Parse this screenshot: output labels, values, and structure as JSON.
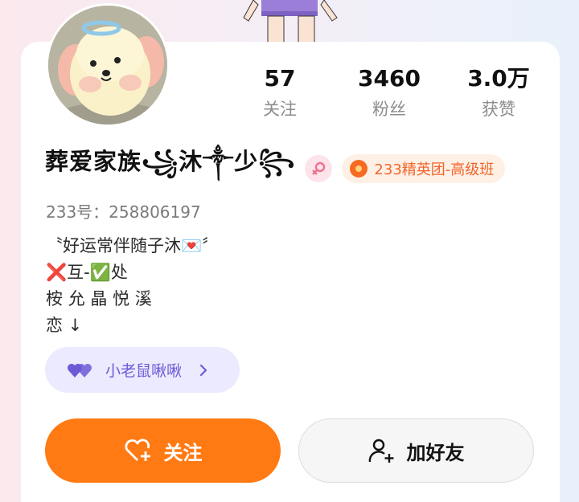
{
  "profile": {
    "stats": [
      {
        "value": "57",
        "label": "关注"
      },
      {
        "value": "3460",
        "label": "粉丝"
      },
      {
        "value": "3.0万",
        "label": "获赞"
      }
    ],
    "name": "葬爱家族꧁沐༒少꧂",
    "badge": "233精英团-高级班",
    "id_line": "233号：258806197",
    "bio": [
      "〝好运常伴随子沐💌〞",
      "❌互-✅处",
      "桉 允 晶 悦 溪",
      "恋 ↓"
    ],
    "group": "小老鼠啾啾"
  },
  "actions": {
    "follow": "关注",
    "add_friend": "加好友"
  },
  "colors": {
    "accent": "#ff7a13",
    "badge_text": "#f0662a",
    "group_text": "#6b5bd6",
    "gender_pink": "#f07092"
  }
}
